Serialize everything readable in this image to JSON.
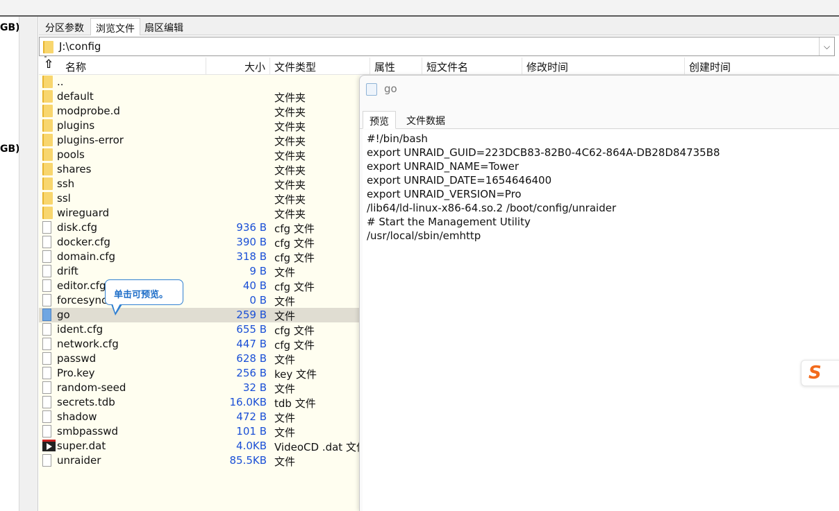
{
  "left_tree": {
    "fragments": [
      "GB)",
      "GB)"
    ]
  },
  "tabs": [
    {
      "label": "分区参数",
      "active": false
    },
    {
      "label": "浏览文件",
      "active": true
    },
    {
      "label": "扇区编辑",
      "active": false
    }
  ],
  "path": {
    "value": "J:\\config"
  },
  "columns": {
    "name": "名称",
    "size": "大小",
    "type": "文件类型",
    "attr": "属性",
    "short": "短文件名",
    "modified": "修改时间",
    "created": "创建时间"
  },
  "files": [
    {
      "name": "..",
      "size": "",
      "type": "",
      "icon": "folder-icon"
    },
    {
      "name": "default",
      "size": "",
      "type": "文件夹",
      "icon": "folder-icon"
    },
    {
      "name": "modprobe.d",
      "size": "",
      "type": "文件夹",
      "icon": "folder-icon"
    },
    {
      "name": "plugins",
      "size": "",
      "type": "文件夹",
      "icon": "folder-icon"
    },
    {
      "name": "plugins-error",
      "size": "",
      "type": "文件夹",
      "icon": "folder-icon"
    },
    {
      "name": "pools",
      "size": "",
      "type": "文件夹",
      "icon": "folder-icon"
    },
    {
      "name": "shares",
      "size": "",
      "type": "文件夹",
      "icon": "folder-icon"
    },
    {
      "name": "ssh",
      "size": "",
      "type": "文件夹",
      "icon": "folder-icon"
    },
    {
      "name": "ssl",
      "size": "",
      "type": "文件夹",
      "icon": "folder-icon"
    },
    {
      "name": "wireguard",
      "size": "",
      "type": "文件夹",
      "icon": "folder-icon"
    },
    {
      "name": "disk.cfg",
      "size": "936 B",
      "type": "cfg 文件",
      "icon": "file-icon"
    },
    {
      "name": "docker.cfg",
      "size": "390 B",
      "type": "cfg 文件",
      "icon": "file-icon"
    },
    {
      "name": "domain.cfg",
      "size": "318 B",
      "type": "cfg 文件",
      "icon": "file-icon"
    },
    {
      "name": "drift",
      "size": "9 B",
      "type": "文件",
      "icon": "file-icon"
    },
    {
      "name": "editor.cfg",
      "size": "40 B",
      "type": "cfg 文件",
      "icon": "file-icon"
    },
    {
      "name": "forcesync",
      "size": "0 B",
      "type": "文件",
      "icon": "file-icon"
    },
    {
      "name": "go",
      "size": "259 B",
      "type": "文件",
      "icon": "file-blue-icon",
      "selected": true
    },
    {
      "name": "ident.cfg",
      "size": "655 B",
      "type": "cfg 文件",
      "icon": "file-icon"
    },
    {
      "name": "network.cfg",
      "size": "447 B",
      "type": "cfg 文件",
      "icon": "file-icon"
    },
    {
      "name": "passwd",
      "size": "628 B",
      "type": "文件",
      "icon": "file-icon"
    },
    {
      "name": "Pro.key",
      "size": "256 B",
      "type": "key 文件",
      "icon": "file-icon"
    },
    {
      "name": "random-seed",
      "size": "32 B",
      "type": "文件",
      "icon": "file-icon"
    },
    {
      "name": "secrets.tdb",
      "size": "16.0KB",
      "type": "tdb 文件",
      "icon": "file-icon"
    },
    {
      "name": "shadow",
      "size": "472 B",
      "type": "文件",
      "icon": "file-icon"
    },
    {
      "name": "smbpasswd",
      "size": "101 B",
      "type": "文件",
      "icon": "file-icon"
    },
    {
      "name": "super.dat",
      "size": "4.0KB",
      "type": "VideoCD .dat 文件",
      "icon": "video-icon"
    },
    {
      "name": "unraider",
      "size": "85.5KB",
      "type": "文件",
      "icon": "file-icon"
    }
  ],
  "tooltip": {
    "text": "单击可预览。"
  },
  "preview": {
    "title": "go",
    "tabs": [
      {
        "label": "预览",
        "active": true
      },
      {
        "label": "文件数据",
        "active": false
      }
    ],
    "lines": [
      "#!/bin/bash",
      "export UNRAID_GUID=223DCB83-82B0-4C62-864A-DB28D84735B8",
      "export UNRAID_NAME=Tower",
      "export UNRAID_DATE=1654646400",
      "export UNRAID_VERSION=Pro",
      "/lib64/ld-linux-x86-64.so.2 /boot/config/unraider",
      "# Start the Management Utility",
      "/usr/local/sbin/emhttp"
    ]
  },
  "ime": {
    "glyph": "S",
    "icon": "sogou-ime-icon",
    "color": "#f26b1d"
  }
}
